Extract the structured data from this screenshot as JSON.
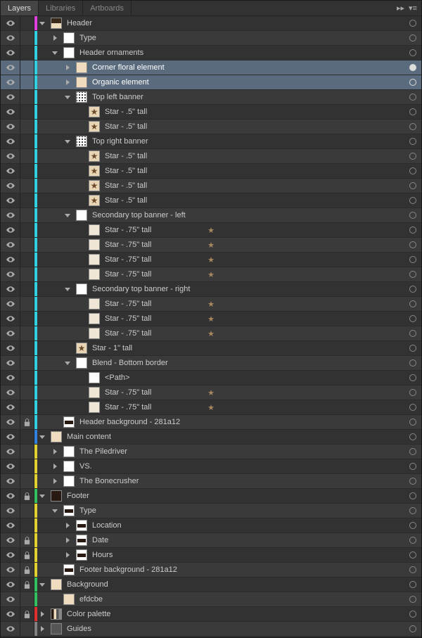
{
  "tabs": {
    "layers": "Layers",
    "libraries": "Libraries",
    "artboards": "Artboards"
  },
  "colors": {
    "magenta": "#e040e0",
    "cyan": "#30d0e0",
    "blue": "#3080e0",
    "green": "#30c060",
    "yellow": "#e0d030",
    "red": "#e03030",
    "gray": "#808080"
  },
  "rows": [
    {
      "d": 0,
      "c": "magenta",
      "arrow": "down",
      "thumb": "header",
      "label": "Header",
      "vis": true,
      "lock": false,
      "tgt": "open"
    },
    {
      "d": 1,
      "c": "cyan",
      "arrow": "right",
      "thumb": "bg-white",
      "label": "Type",
      "vis": true,
      "lock": false,
      "tgt": "open"
    },
    {
      "d": 1,
      "c": "cyan",
      "arrow": "down",
      "thumb": "bg-white",
      "label": "Header ornaments",
      "vis": true,
      "lock": false,
      "tgt": "open"
    },
    {
      "d": 2,
      "c": "cyan",
      "arrow": "right",
      "thumb": "bg-cream",
      "label": "Corner floral element",
      "vis": true,
      "lock": false,
      "tgt": "fill",
      "sel": true
    },
    {
      "d": 2,
      "c": "cyan",
      "arrow": "right",
      "thumb": "bg-cream",
      "label": "Organic element",
      "vis": true,
      "lock": false,
      "tgt": "open",
      "sel": true
    },
    {
      "d": 2,
      "c": "cyan",
      "arrow": "down",
      "thumb": "bg-dots",
      "label": "Top left banner",
      "vis": true,
      "lock": false,
      "tgt": "open"
    },
    {
      "d": 3,
      "c": "cyan",
      "arrow": "none",
      "thumb": "star",
      "label": "Star - .5\" tall",
      "vis": true,
      "lock": false,
      "tgt": "open"
    },
    {
      "d": 3,
      "c": "cyan",
      "arrow": "none",
      "thumb": "star",
      "label": "Star - .5\" tall",
      "vis": true,
      "lock": false,
      "tgt": "open"
    },
    {
      "d": 2,
      "c": "cyan",
      "arrow": "down",
      "thumb": "bg-dots",
      "label": "Top right banner",
      "vis": true,
      "lock": false,
      "tgt": "open"
    },
    {
      "d": 3,
      "c": "cyan",
      "arrow": "none",
      "thumb": "star",
      "label": "Star - .5\" tall",
      "vis": true,
      "lock": false,
      "tgt": "open"
    },
    {
      "d": 3,
      "c": "cyan",
      "arrow": "none",
      "thumb": "star",
      "label": "Star - .5\" tall",
      "vis": true,
      "lock": false,
      "tgt": "open"
    },
    {
      "d": 3,
      "c": "cyan",
      "arrow": "none",
      "thumb": "star",
      "label": "Star - .5\" tall",
      "vis": true,
      "lock": false,
      "tgt": "open"
    },
    {
      "d": 3,
      "c": "cyan",
      "arrow": "none",
      "thumb": "star",
      "label": "Star - .5\" tall",
      "vis": true,
      "lock": false,
      "tgt": "open"
    },
    {
      "d": 2,
      "c": "cyan",
      "arrow": "down",
      "thumb": "bg-white",
      "label": "Secondary top banner - left",
      "vis": true,
      "lock": false,
      "tgt": "open"
    },
    {
      "d": 3,
      "c": "cyan",
      "arrow": "none",
      "thumb": "star75",
      "label": "Star - .75\" tall",
      "vis": true,
      "lock": false,
      "tgt": "open"
    },
    {
      "d": 3,
      "c": "cyan",
      "arrow": "none",
      "thumb": "star75",
      "label": "Star - .75\" tall",
      "vis": true,
      "lock": false,
      "tgt": "open"
    },
    {
      "d": 3,
      "c": "cyan",
      "arrow": "none",
      "thumb": "star75",
      "label": "Star - .75\" tall",
      "vis": true,
      "lock": false,
      "tgt": "open"
    },
    {
      "d": 3,
      "c": "cyan",
      "arrow": "none",
      "thumb": "star75",
      "label": "Star - .75\" tall",
      "vis": true,
      "lock": false,
      "tgt": "open"
    },
    {
      "d": 2,
      "c": "cyan",
      "arrow": "down",
      "thumb": "bg-white",
      "label": "Secondary top banner - right",
      "vis": true,
      "lock": false,
      "tgt": "open"
    },
    {
      "d": 3,
      "c": "cyan",
      "arrow": "none",
      "thumb": "star75",
      "label": "Star - .75\" tall",
      "vis": true,
      "lock": false,
      "tgt": "open"
    },
    {
      "d": 3,
      "c": "cyan",
      "arrow": "none",
      "thumb": "star75",
      "label": "Star - .75\" tall",
      "vis": true,
      "lock": false,
      "tgt": "open"
    },
    {
      "d": 3,
      "c": "cyan",
      "arrow": "none",
      "thumb": "star75",
      "label": "Star - .75\" tall",
      "vis": true,
      "lock": false,
      "tgt": "open"
    },
    {
      "d": 2,
      "c": "cyan",
      "arrow": "none",
      "thumb": "star",
      "label": "Star - 1\" tall",
      "vis": true,
      "lock": false,
      "tgt": "open"
    },
    {
      "d": 2,
      "c": "cyan",
      "arrow": "down",
      "thumb": "bg-white",
      "label": "Blend - Bottom border",
      "vis": true,
      "lock": false,
      "tgt": "open"
    },
    {
      "d": 3,
      "c": "cyan",
      "arrow": "none",
      "thumb": "bg-white",
      "label": "<Path>",
      "vis": true,
      "lock": false,
      "tgt": "open"
    },
    {
      "d": 3,
      "c": "cyan",
      "arrow": "none",
      "thumb": "star75",
      "label": "Star - .75\" tall",
      "vis": true,
      "lock": false,
      "tgt": "open"
    },
    {
      "d": 3,
      "c": "cyan",
      "arrow": "none",
      "thumb": "star75",
      "label": "Star - .75\" tall",
      "vis": true,
      "lock": false,
      "tgt": "open"
    },
    {
      "d": 1,
      "c": "cyan",
      "arrow": "none",
      "thumb": "banner",
      "label": "Header background - 281a12",
      "vis": true,
      "lock": true,
      "tgt": "open"
    },
    {
      "d": 0,
      "c": "blue",
      "arrow": "down",
      "thumb": "bg-cream",
      "label": "Main content",
      "vis": true,
      "lock": false,
      "tgt": "open"
    },
    {
      "d": 1,
      "c": "yellow",
      "arrow": "right",
      "thumb": "bg-white",
      "label": "The Piledriver",
      "vis": true,
      "lock": false,
      "tgt": "open"
    },
    {
      "d": 1,
      "c": "yellow",
      "arrow": "right",
      "thumb": "bg-white",
      "label": "VS.",
      "vis": true,
      "lock": false,
      "tgt": "open"
    },
    {
      "d": 1,
      "c": "yellow",
      "arrow": "right",
      "thumb": "bg-white",
      "label": "The Bonecrusher",
      "vis": true,
      "lock": false,
      "tgt": "open"
    },
    {
      "d": 0,
      "c": "green",
      "arrow": "down",
      "thumb": "bg-brown",
      "label": "Footer",
      "vis": true,
      "lock": true,
      "tgt": "open"
    },
    {
      "d": 1,
      "c": "yellow",
      "arrow": "down",
      "thumb": "banner",
      "label": "Type",
      "vis": true,
      "lock": false,
      "tgt": "open"
    },
    {
      "d": 2,
      "c": "yellow",
      "arrow": "right",
      "thumb": "banner",
      "label": "Location",
      "vis": true,
      "lock": false,
      "tgt": "open"
    },
    {
      "d": 2,
      "c": "yellow",
      "arrow": "right",
      "thumb": "banner",
      "label": "Date",
      "vis": true,
      "lock": true,
      "tgt": "open"
    },
    {
      "d": 2,
      "c": "yellow",
      "arrow": "right",
      "thumb": "banner",
      "label": "Hours",
      "vis": true,
      "lock": true,
      "tgt": "open"
    },
    {
      "d": 1,
      "c": "yellow",
      "arrow": "none",
      "thumb": "banner",
      "label": "Footer background - 281a12",
      "vis": true,
      "lock": true,
      "tgt": "open"
    },
    {
      "d": 0,
      "c": "green",
      "arrow": "down",
      "thumb": "bg-cream",
      "label": "Background",
      "vis": true,
      "lock": true,
      "tgt": "open"
    },
    {
      "d": 1,
      "c": "green",
      "arrow": "none",
      "thumb": "bg-cream",
      "label": "efdcbe",
      "vis": true,
      "lock": false,
      "tgt": "open"
    },
    {
      "d": 0,
      "c": "red",
      "arrow": "right",
      "thumb": "palette",
      "label": "Color palette",
      "vis": true,
      "lock": true,
      "tgt": "open"
    },
    {
      "d": 0,
      "c": "gray",
      "arrow": "right",
      "thumb": "folder",
      "label": "Guides",
      "vis": true,
      "lock": false,
      "tgt": "open"
    }
  ]
}
